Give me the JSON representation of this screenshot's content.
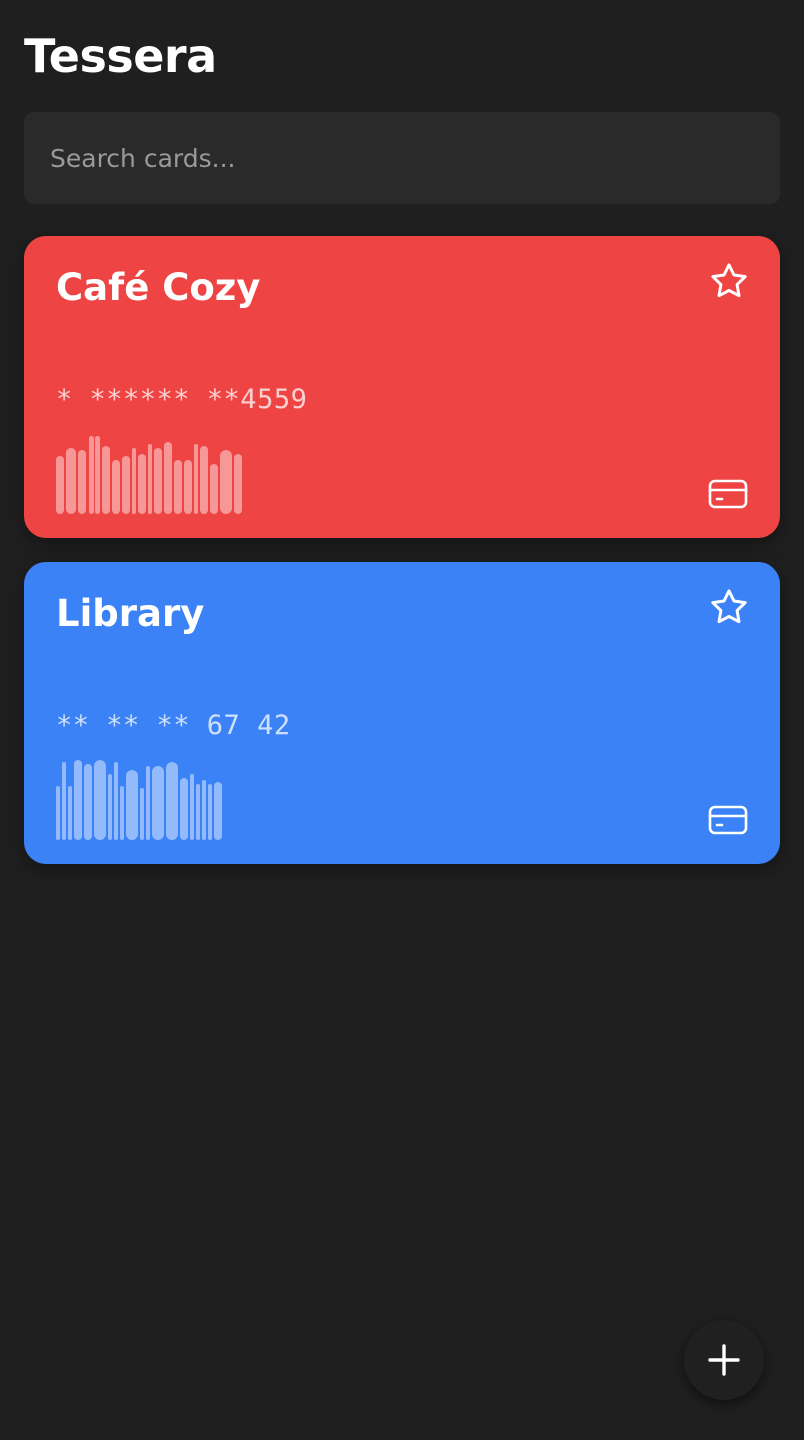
{
  "header": {
    "title": "Tessera"
  },
  "search": {
    "placeholder": "Search cards...",
    "value": ""
  },
  "cards": [
    {
      "name": "Café Cozy",
      "number": "* ****** **4559",
      "color": "#ef4444",
      "favorite": false,
      "star_icon": "star-outline-icon",
      "type_icon": "credit-card-icon"
    },
    {
      "name": "Library",
      "number": "** ** ** 67 42",
      "color": "#3b82f6",
      "favorite": false,
      "star_icon": "star-outline-icon",
      "type_icon": "credit-card-icon"
    }
  ],
  "fab": {
    "icon": "plus-icon",
    "background": "#202020"
  },
  "colors": {
    "background": "#1f1f1f",
    "search_background": "#2a2a2a",
    "placeholder": "#9a9a9a"
  }
}
